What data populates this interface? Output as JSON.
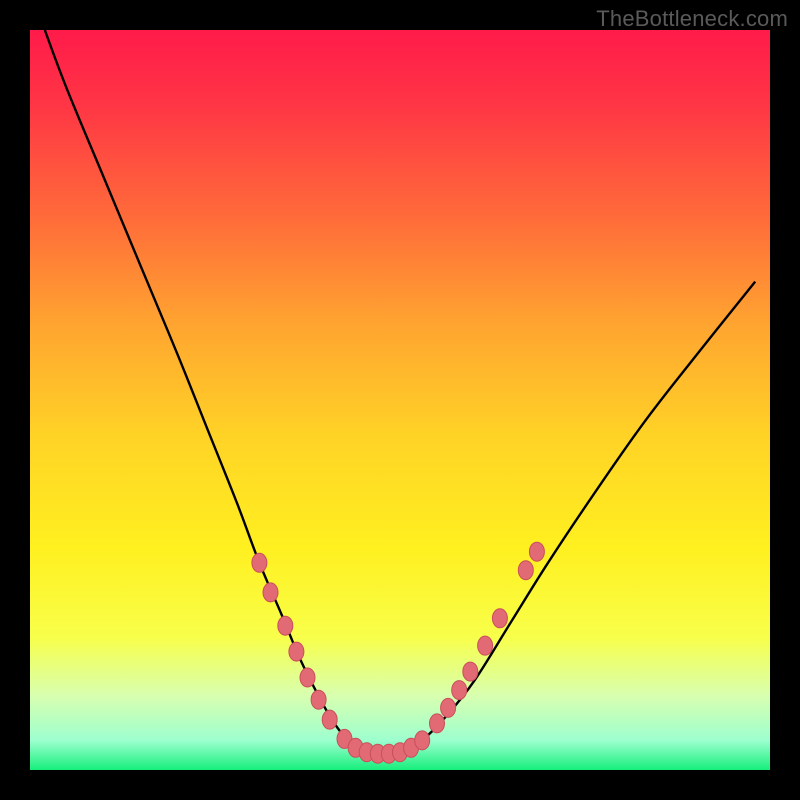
{
  "watermark": "TheBottleneck.com",
  "colors": {
    "frame": "#000000",
    "gradient_stops": [
      {
        "offset": 0.0,
        "color": "#ff1b4a"
      },
      {
        "offset": 0.1,
        "color": "#ff3545"
      },
      {
        "offset": 0.25,
        "color": "#ff6a3a"
      },
      {
        "offset": 0.4,
        "color": "#ffa530"
      },
      {
        "offset": 0.55,
        "color": "#ffd326"
      },
      {
        "offset": 0.7,
        "color": "#fff020"
      },
      {
        "offset": 0.82,
        "color": "#f8ff4a"
      },
      {
        "offset": 0.9,
        "color": "#d8ffb0"
      },
      {
        "offset": 0.96,
        "color": "#9dffcf"
      },
      {
        "offset": 1.0,
        "color": "#17ef7c"
      }
    ],
    "curve": "#000000",
    "dot_fill": "#e16a74",
    "dot_stroke": "#c94f5b"
  },
  "chart_data": {
    "type": "line",
    "title": "",
    "xlabel": "",
    "ylabel": "",
    "xlim": [
      0,
      100
    ],
    "ylim": [
      0,
      100
    ],
    "series": [
      {
        "name": "bottleneck-curve",
        "x": [
          2,
          5,
          10,
          15,
          20,
          24,
          28,
          31,
          34,
          36.5,
          39,
          41,
          43,
          45,
          47,
          49,
          51,
          53,
          56,
          60,
          65,
          70,
          76,
          83,
          90,
          98
        ],
        "y": [
          100,
          92,
          80,
          68,
          56,
          46,
          36,
          28,
          21,
          15,
          10,
          6.5,
          4,
          2.7,
          2.2,
          2.2,
          2.7,
          4,
          7,
          12,
          20,
          28,
          37,
          47,
          56,
          66
        ]
      }
    ],
    "highlight_dots": {
      "name": "marker-dots",
      "points": [
        {
          "x": 31.0,
          "y": 28.0
        },
        {
          "x": 32.5,
          "y": 24.0
        },
        {
          "x": 34.5,
          "y": 19.5
        },
        {
          "x": 36.0,
          "y": 16.0
        },
        {
          "x": 37.5,
          "y": 12.5
        },
        {
          "x": 39.0,
          "y": 9.5
        },
        {
          "x": 40.5,
          "y": 6.8
        },
        {
          "x": 42.5,
          "y": 4.2
        },
        {
          "x": 44.0,
          "y": 3.0
        },
        {
          "x": 45.5,
          "y": 2.4
        },
        {
          "x": 47.0,
          "y": 2.2
        },
        {
          "x": 48.5,
          "y": 2.2
        },
        {
          "x": 50.0,
          "y": 2.4
        },
        {
          "x": 51.5,
          "y": 3.0
        },
        {
          "x": 53.0,
          "y": 4.0
        },
        {
          "x": 55.0,
          "y": 6.3
        },
        {
          "x": 56.5,
          "y": 8.4
        },
        {
          "x": 58.0,
          "y": 10.8
        },
        {
          "x": 59.5,
          "y": 13.3
        },
        {
          "x": 61.5,
          "y": 16.8
        },
        {
          "x": 63.5,
          "y": 20.5
        },
        {
          "x": 67.0,
          "y": 27.0
        },
        {
          "x": 68.5,
          "y": 29.5
        }
      ]
    }
  }
}
